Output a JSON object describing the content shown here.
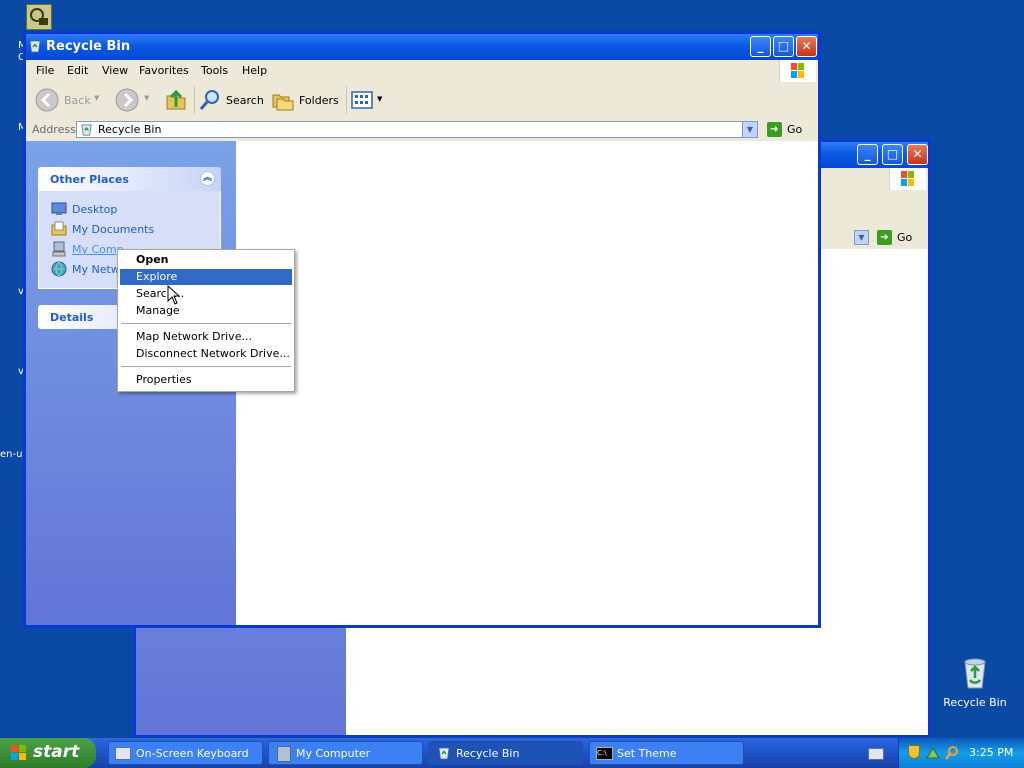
{
  "desktop": {
    "recycle_bin_label": "Recycle Bin",
    "edge_fragments": [
      "M",
      "C",
      "M",
      "v",
      "v",
      "en-u"
    ]
  },
  "back_window": {
    "address_go": "Go"
  },
  "front_window": {
    "title": "Recycle Bin",
    "menu": [
      "File",
      "Edit",
      "View",
      "Favorites",
      "Tools",
      "Help"
    ],
    "toolbar": {
      "back": "Back",
      "search": "Search",
      "folders": "Folders"
    },
    "address": {
      "label": "Address",
      "value": "Recycle Bin",
      "go": "Go"
    },
    "taskpane": {
      "other_places": {
        "title": "Other Places",
        "items": [
          "Desktop",
          "My Documents",
          "My Comp",
          "My Netw"
        ]
      },
      "details": {
        "title": "Details"
      }
    }
  },
  "context_menu": {
    "items": [
      "Open",
      "Explore",
      "Search...",
      "Manage",
      "Map Network Drive...",
      "Disconnect Network Drive...",
      "Properties"
    ],
    "highlighted": "Explore"
  },
  "taskbar": {
    "start": "start",
    "tasks": [
      "On-Screen Keyboard",
      "My Computer",
      "Recycle Bin",
      "Set Theme"
    ],
    "active_task": "Recycle Bin",
    "clock": "3:25 PM"
  },
  "colors": {
    "desktop": "#0a4aa4",
    "titlebar": "#0a5ae6",
    "highlight": "#316ac5",
    "taskpane_link": "#215dc6"
  }
}
